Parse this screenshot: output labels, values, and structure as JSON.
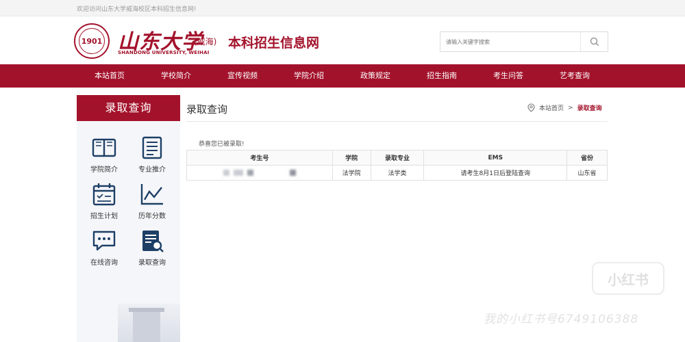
{
  "topbar": {
    "welcome": "欢迎访问山东大学威海校区本科招生信息网!"
  },
  "logo": {
    "seal_text": "1901",
    "name_cn": "山东大学",
    "campus": "(威海)",
    "name_en": "SHANDONG UNIVERSITY, WEIHAI"
  },
  "site_title": "本科招生信息网",
  "search": {
    "placeholder": "请输入关键字搜索"
  },
  "nav": [
    "本站首页",
    "学校简介",
    "宣传视频",
    "学院介绍",
    "政策规定",
    "招生指南",
    "考生问答",
    "艺考查询"
  ],
  "sidebar": {
    "heading": "录取查询",
    "items": [
      {
        "label": "学院简介",
        "icon": "book-icon"
      },
      {
        "label": "专业推介",
        "icon": "document-icon"
      },
      {
        "label": "招生计划",
        "icon": "calendar-icon"
      },
      {
        "label": "历年分数",
        "icon": "trend-chart-icon"
      },
      {
        "label": "在线咨询",
        "icon": "chat-icon"
      },
      {
        "label": "录取查询",
        "icon": "search-doc-icon"
      }
    ]
  },
  "content": {
    "title": "录取查询",
    "breadcrumb": {
      "home": "本站首页",
      "separator": ">",
      "current": "录取查询"
    },
    "congrats": "恭喜您已被录取!",
    "table": {
      "headers": [
        "考生号",
        "学院",
        "录取专业",
        "EMS",
        "省份"
      ],
      "row": {
        "college": "法学院",
        "major": "法学类",
        "ems": "请考生8月1日后登陆查询",
        "province": "山东省"
      }
    }
  },
  "watermark": {
    "brand": "小红书",
    "text": "我的小红书号6749106388"
  },
  "colors": {
    "brand": "#a3122b",
    "sidebar_bg": "#f5f6f9"
  }
}
